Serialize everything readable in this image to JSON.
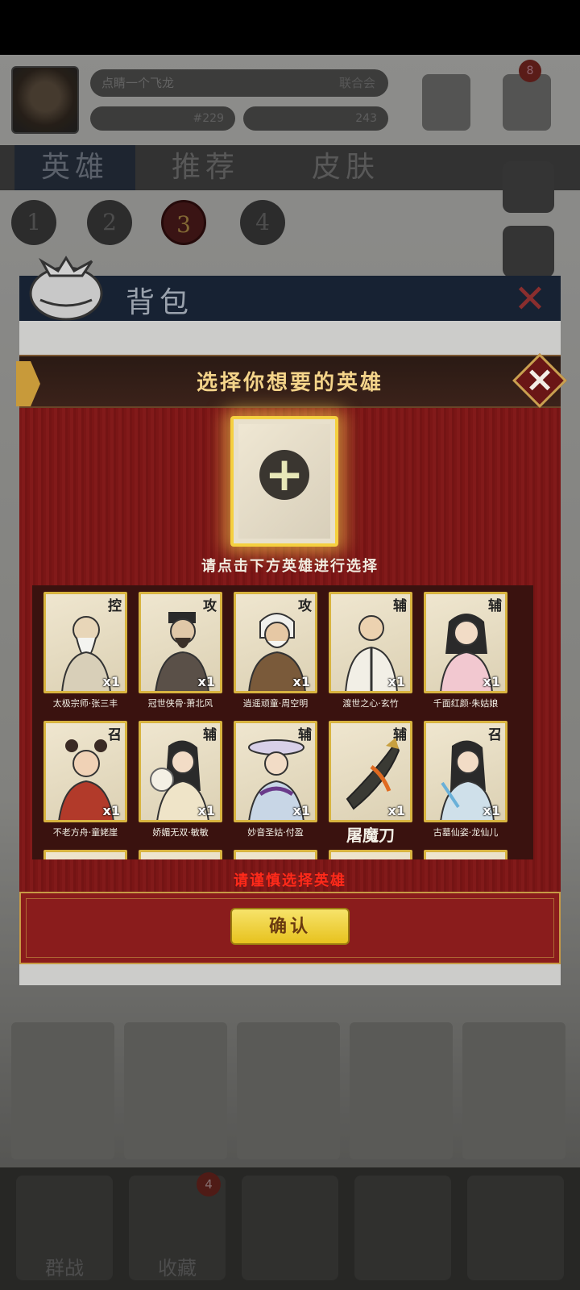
{
  "background": {
    "player_name": "点睛一个飞龙",
    "player_tag": "联合会",
    "currency_1": "#229",
    "currency_2": "243",
    "notification_count": "8",
    "main_tabs": [
      "英雄",
      "推荐",
      "皮肤"
    ],
    "steps": [
      "1",
      "2",
      "3",
      "4"
    ],
    "nav_labels": [
      "群战",
      "收藏",
      "",
      "",
      ""
    ],
    "nav_badge": "4"
  },
  "backpack": {
    "title": "背包"
  },
  "dialog": {
    "title": "选择你想要的英雄",
    "hint": "请点击下方英雄进行选择",
    "warning": "请谨慎选择英雄",
    "confirm_label": "确认",
    "close_icon": "×",
    "plus_icon": "+"
  },
  "heroes": [
    {
      "role": "控",
      "qty": "x1",
      "name": "太极宗师·张三丰"
    },
    {
      "role": "攻",
      "qty": "x1",
      "name": "冠世侠骨·萧北风"
    },
    {
      "role": "攻",
      "qty": "x1",
      "name": "逍遥顽童·周空明"
    },
    {
      "role": "辅",
      "qty": "x1",
      "name": "渡世之心·玄竹"
    },
    {
      "role": "辅",
      "qty": "x1",
      "name": "千面红颜·朱姑娘"
    },
    {
      "role": "召",
      "qty": "x1",
      "name": "不老方舟·童姥崖"
    },
    {
      "role": "辅",
      "qty": "x1",
      "name": "娇媚无双·敏敏"
    },
    {
      "role": "辅",
      "qty": "x1",
      "name": "妙音圣姑·付盈"
    },
    {
      "role": "辅",
      "qty": "x1",
      "name": "屠魔刀"
    },
    {
      "role": "召",
      "qty": "x1",
      "name": "古墓仙姿·龙仙儿"
    }
  ]
}
